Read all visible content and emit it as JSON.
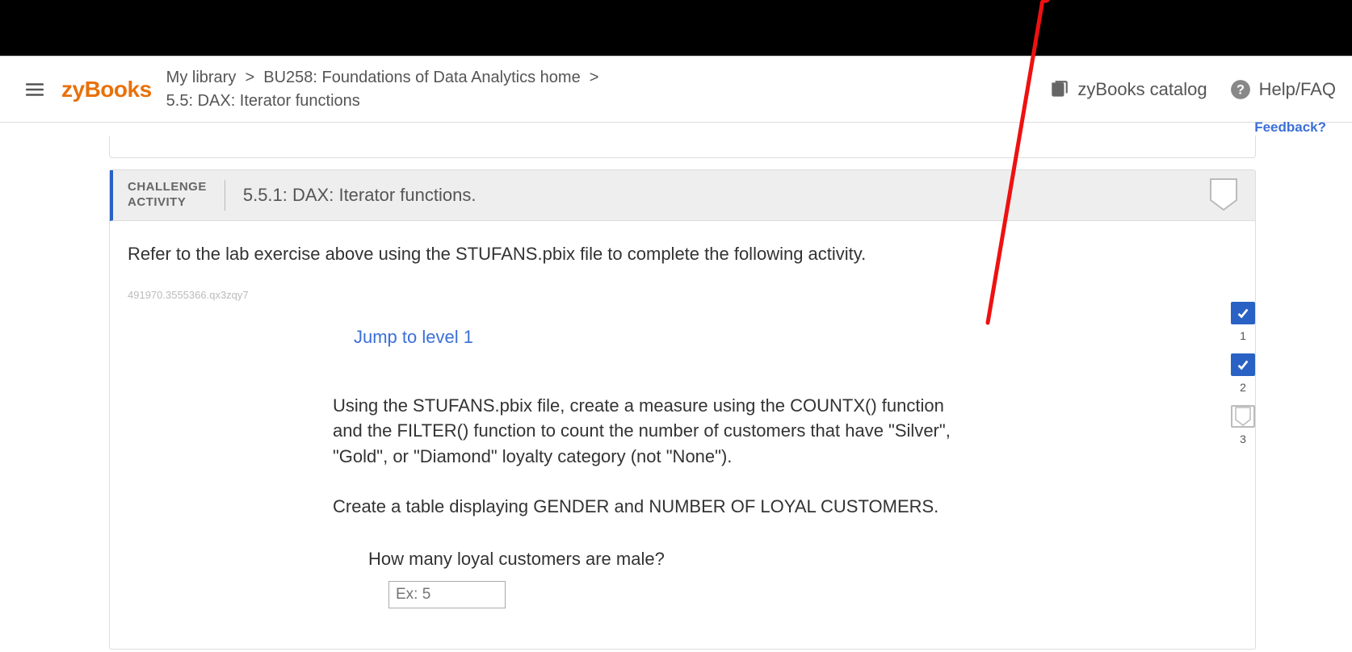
{
  "header": {
    "logo_zy": "zy",
    "logo_books": "Books",
    "breadcrumb_library": "My library",
    "breadcrumb_course": "BU258: Foundations of Data Analytics home",
    "breadcrumb_section": "5.5: DAX: Iterator functions",
    "catalog_label": "zyBooks catalog",
    "help_label": "Help/FAQ"
  },
  "feedback_label": "Feedback?",
  "activity": {
    "badge_line1": "CHALLENGE",
    "badge_line2": "ACTIVITY",
    "title": "5.5.1: DAX: Iterator functions.",
    "intro": "Refer to the lab exercise above using the STUFANS.pbix file to complete the following activity.",
    "internal_id": "491970.3555366.qx3zqy7",
    "jump_label": "Jump to level 1",
    "para1": "Using the STUFANS.pbix file, create a measure using the COUNTX() function and the FILTER() function to count the number of customers that have \"Silver\", \"Gold\", or \"Diamond\" loyalty category (not \"None\").",
    "para2": "Create a table displaying GENDER and NUMBER OF LOYAL CUSTOMERS.",
    "question": "How many loyal customers are male?",
    "answer_placeholder": "Ex: 5"
  },
  "levels": {
    "l1": "1",
    "l2": "2",
    "l3": "3"
  }
}
